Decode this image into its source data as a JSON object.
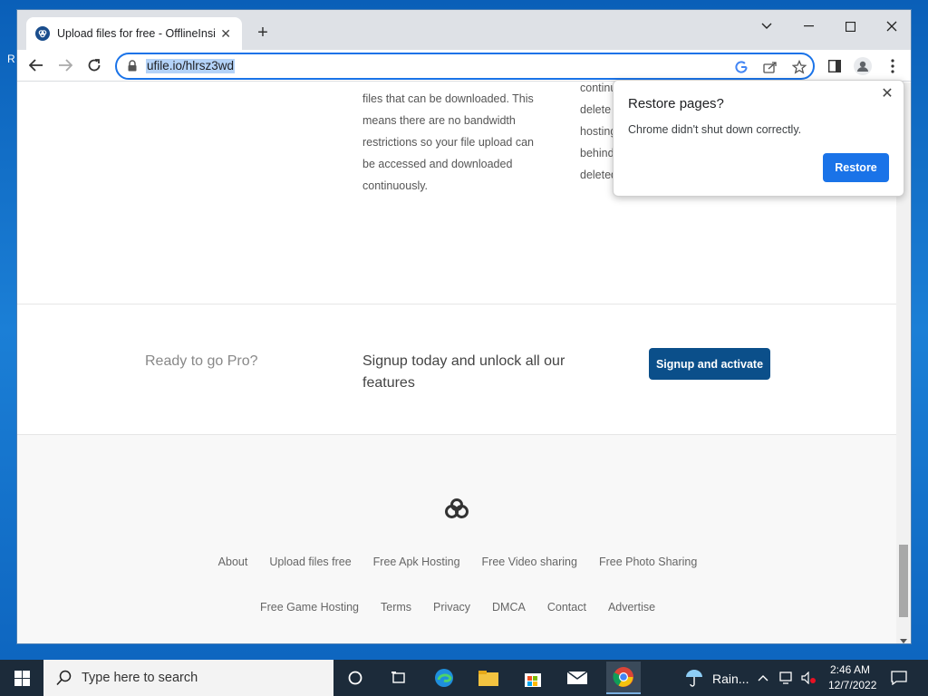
{
  "browser": {
    "tab_title": "Upload files for free - OfflineInsi",
    "url": "ufile.io/hlrsz3wd"
  },
  "page": {
    "feature_left_lines": [
      "files that can be downloaded. This",
      "means there are no bandwidth",
      "restrictions so your file upload can",
      "be accessed and downloaded",
      "continuously."
    ],
    "feature_right_lines": [
      "continu",
      "delete",
      "hosting",
      "behind",
      "deleted"
    ],
    "pro_title": "Ready to go Pro?",
    "pro_desc": "Signup today and unlock all our features",
    "pro_button": "Signup and activate",
    "footer_links_row1": [
      "About",
      "Upload files free",
      "Free Apk Hosting",
      "Free Video sharing",
      "Free Photo Sharing"
    ],
    "footer_links_row2": [
      "Free Game Hosting",
      "Terms",
      "Privacy",
      "DMCA",
      "Contact",
      "Advertise"
    ]
  },
  "popup": {
    "title": "Restore pages?",
    "message": "Chrome didn't shut down correctly.",
    "button": "Restore"
  },
  "taskbar": {
    "search_placeholder": "Type here to search",
    "weather": "Rain...",
    "time": "2:46 AM",
    "date": "12/7/2022"
  },
  "colors": {
    "accent": "#1a73e8",
    "pro_button": "#0b4f8a",
    "taskbar": "#1c2b3a"
  }
}
